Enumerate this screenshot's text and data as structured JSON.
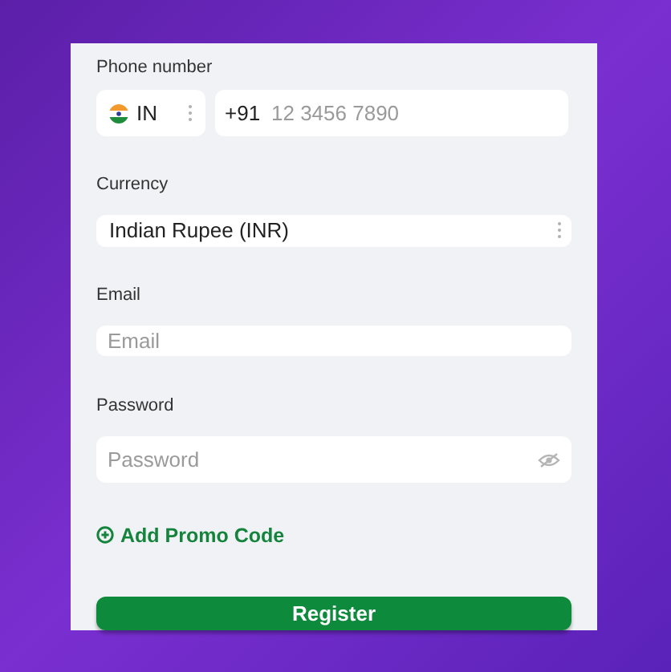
{
  "phone": {
    "label": "Phone number",
    "country": "IN",
    "prefix": "+91",
    "placeholder": "12 3456 7890"
  },
  "currency": {
    "label": "Currency",
    "value": "Indian Rupee (INR)"
  },
  "email": {
    "label": "Email",
    "placeholder": "Email"
  },
  "password": {
    "label": "Password",
    "placeholder": "Password"
  },
  "promo": "Add Promo Code",
  "submit": "Register"
}
